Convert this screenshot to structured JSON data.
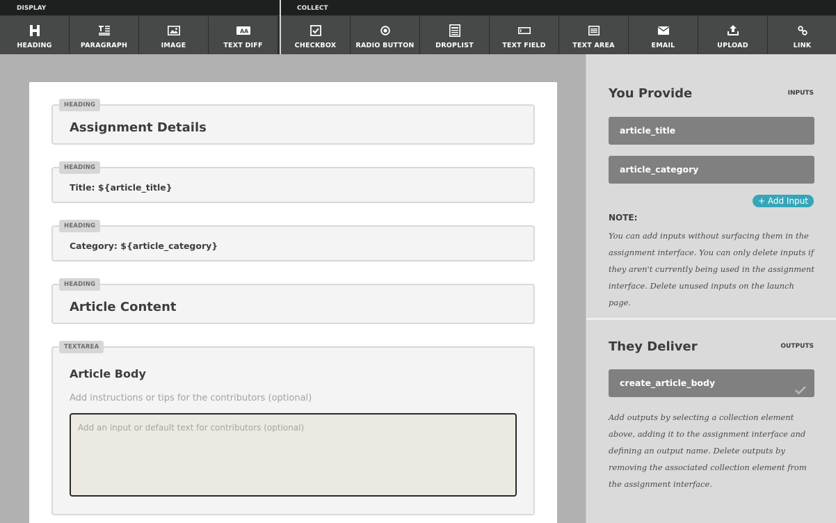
{
  "toolbar": {
    "display_group": {
      "label": "DISPLAY",
      "tools": [
        {
          "label": "HEADING",
          "icon": "heading-icon"
        },
        {
          "label": "PARAGRAPH",
          "icon": "paragraph-icon"
        },
        {
          "label": "IMAGE",
          "icon": "image-icon"
        },
        {
          "label": "TEXT DIFF",
          "icon": "text-diff-icon"
        }
      ]
    },
    "collect_group": {
      "label": "COLLECT",
      "tools": [
        {
          "label": "CHECKBOX",
          "icon": "checkbox-icon"
        },
        {
          "label": "RADIO BUTTON",
          "icon": "radio-button-icon"
        },
        {
          "label": "DROPLIST",
          "icon": "droplist-icon"
        },
        {
          "label": "TEXT FIELD",
          "icon": "text-field-icon"
        },
        {
          "label": "TEXT AREA",
          "icon": "text-area-icon"
        },
        {
          "label": "EMAIL",
          "icon": "email-icon"
        },
        {
          "label": "UPLOAD",
          "icon": "upload-icon"
        },
        {
          "label": "LINK",
          "icon": "link-icon"
        }
      ]
    }
  },
  "canvas": {
    "blocks": [
      {
        "tag": "HEADING",
        "text": "Assignment Details"
      },
      {
        "tag": "HEADING",
        "text": "Title: ${article_title}"
      },
      {
        "tag": "HEADING",
        "text": "Category: ${article_category}"
      },
      {
        "tag": "HEADING",
        "text": "Article Content"
      },
      {
        "tag": "TEXTAREA",
        "title": "Article Body",
        "help": "Add instructions or tips for the contributors (optional)",
        "placeholder": "Add an input or default text for contributors (optional)"
      }
    ]
  },
  "panel": {
    "provide": {
      "title": "You Provide",
      "caption": "INPUTS",
      "inputs": [
        "article_title",
        "article_category"
      ],
      "add_label": "+ Add Input",
      "note_title": "NOTE:",
      "note": "You can add inputs without surfacing them in the assignment interface. You can only delete inputs if they aren't currently being used in the assignment interface. Delete unused inputs on the launch page."
    },
    "deliver": {
      "title": "They Deliver",
      "caption": "OUTPUTS",
      "outputs": [
        "create_article_body"
      ],
      "note": "Add outputs by selecting a collection element above, adding it to the assignment interface and defining an output name. Delete outputs by removing the associated collection element from the assignment interface."
    }
  },
  "colors": {
    "toolbar_bg": "#464948",
    "accent": "#35a6b8",
    "pill": "#808080"
  }
}
